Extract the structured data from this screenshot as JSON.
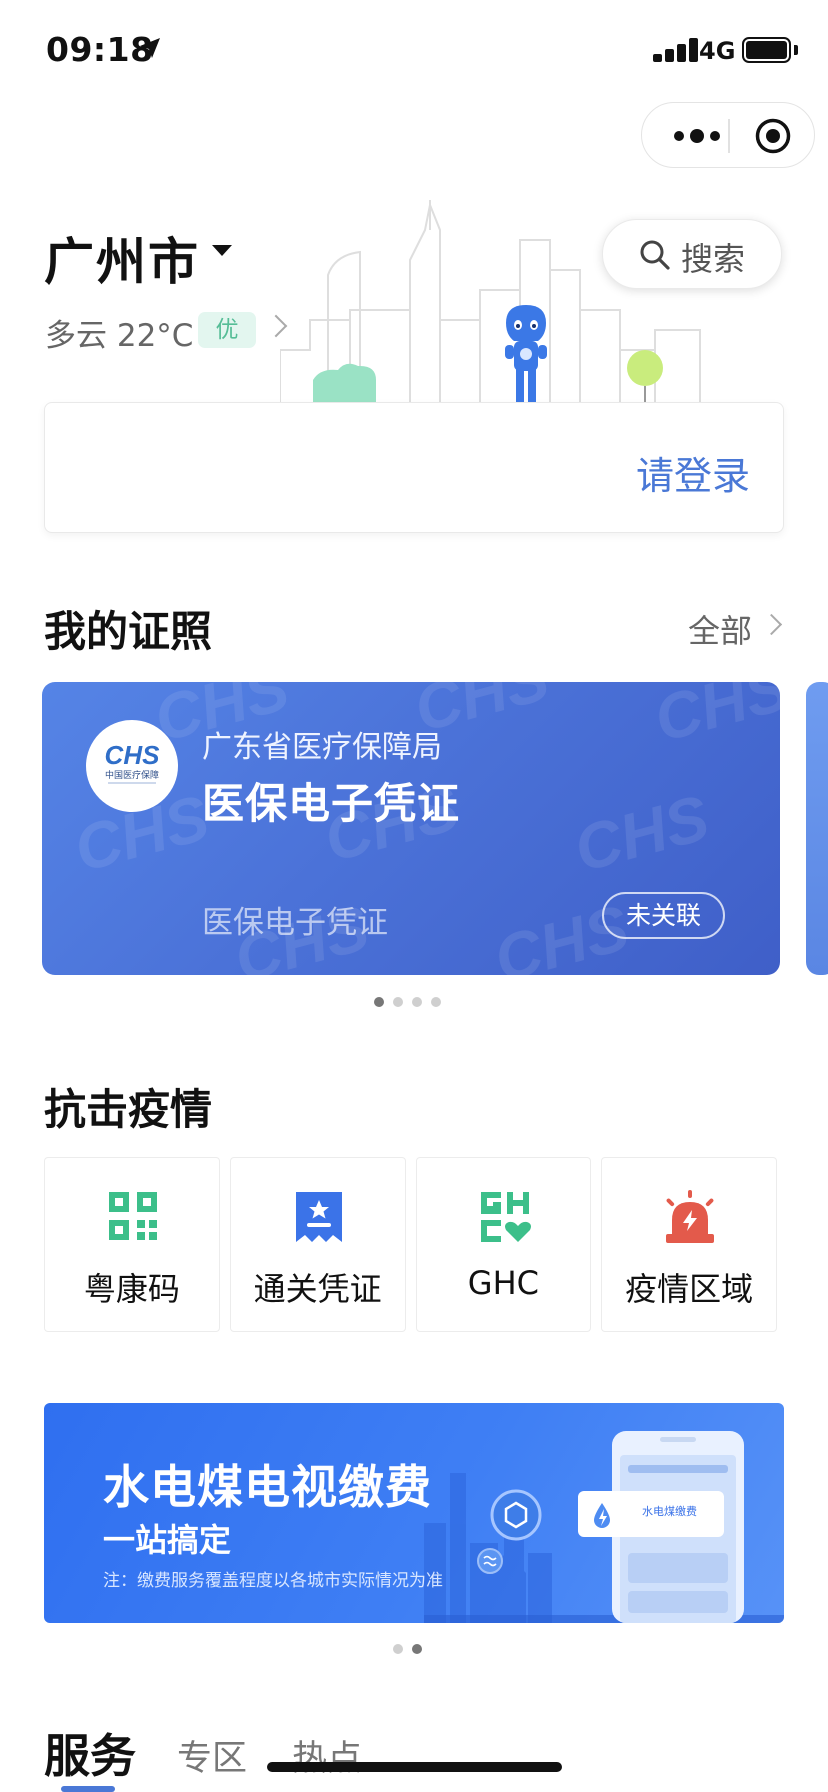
{
  "status_bar": {
    "time": "09:18",
    "network": "4G"
  },
  "header": {
    "city": "广州市",
    "weather": "多云 22°C",
    "aqi": "优",
    "search_label": "搜索"
  },
  "login": {
    "label": "请登录"
  },
  "credentials": {
    "title": "我的证照",
    "see_all": "全部",
    "card": {
      "issuer": "广东省医疗保障局",
      "name": "医保电子凭证",
      "subtitle": "医保电子凭证",
      "status": "未关联",
      "logo_text": "CHS",
      "logo_caption": "中国医疗保障"
    },
    "pages": 4,
    "active_page": 0
  },
  "epidemic": {
    "title": "抗击疫情",
    "tiles": [
      {
        "label": "粤康码",
        "icon": "qr-code-icon",
        "color": "#3cbf8a"
      },
      {
        "label": "通关凭证",
        "icon": "ticket-star-icon",
        "color": "#3b73e8"
      },
      {
        "label": "GHC",
        "icon": "ghc-heart-icon",
        "color": "#3cbf8a"
      },
      {
        "label": "疫情区域",
        "icon": "alarm-light-icon",
        "color": "#e35a4b"
      }
    ]
  },
  "banner": {
    "title": "水电煤电视缴费",
    "subtitle": "一站搞定",
    "note": "注：缴费服务覆盖程度以各城市实际情况为准",
    "card_label": "水电煤缴费",
    "pages": 2,
    "active_page": 1
  },
  "tabs": [
    {
      "label": "服务",
      "active": true
    },
    {
      "label": "专区",
      "active": false
    },
    {
      "label": "热点",
      "active": false
    }
  ],
  "colors": {
    "accent": "#4a78d6",
    "card_blue": "#4b72d8",
    "aqi_green": "#55bd96"
  }
}
